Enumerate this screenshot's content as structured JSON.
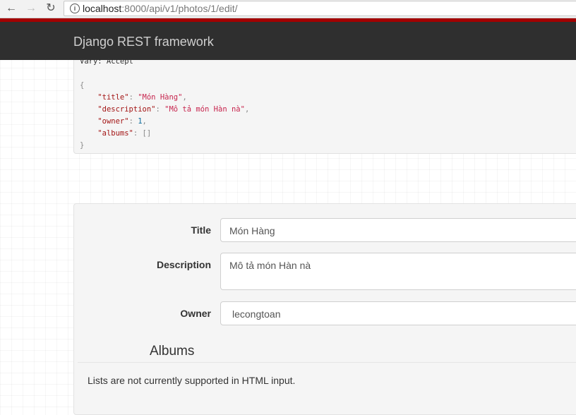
{
  "browser": {
    "url_host": "localhost",
    "url_path": ":8000/api/v1/photos/1/edit/",
    "back_icon": "arrow-left-icon",
    "forward_icon": "arrow-right-icon",
    "reload_icon": "reload-icon",
    "info_icon": "info-icon"
  },
  "navbar": {
    "brand": "Django REST framework"
  },
  "response": {
    "header_fragment": "Vary: Accept",
    "title_key": "\"title\"",
    "title_value": "\"Món Hàng\"",
    "description_key": "\"description\"",
    "description_value": "\"Mô tả món Hàn nà\"",
    "owner_key": "\"owner\"",
    "owner_value": "1",
    "albums_key": "\"albums\"",
    "albums_value": "[]"
  },
  "form": {
    "title_label": "Title",
    "title_value": "Món Hàng",
    "description_label": "Description",
    "description_value": "Mô tả món Hàn nà",
    "owner_label": "Owner",
    "owner_value": "lecongtoan",
    "albums_heading": "Albums",
    "albums_note": "Lists are not currently supported in HTML input."
  },
  "colors": {
    "navbar": "#2f2f2f",
    "navbar_accent": "#a30000"
  }
}
